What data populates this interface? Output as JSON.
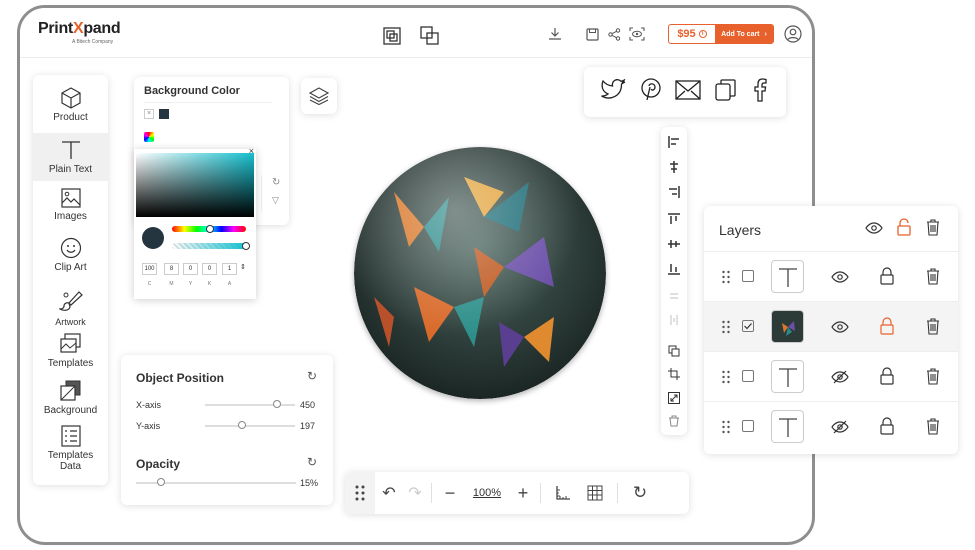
{
  "header": {
    "logo_text_a": "Print",
    "logo_text_x": "X",
    "logo_text_b": "pand",
    "logo_subtitle": "A Bitech Company",
    "price": "$95",
    "add_to_cart": "Add To cart"
  },
  "sidebar": {
    "items": [
      {
        "label": "Product",
        "icon": "cube-icon"
      },
      {
        "label": "Plain Text",
        "icon": "text-icon"
      },
      {
        "label": "Images",
        "icon": "image-icon"
      },
      {
        "label": "Clip Art",
        "icon": "smiley-icon"
      },
      {
        "label": "Artwork",
        "icon": "paintbrush-icon"
      },
      {
        "label": "Templates",
        "icon": "templates-icon"
      },
      {
        "label": "Background",
        "icon": "background-icon"
      },
      {
        "label": "Templates",
        "label2": "Data",
        "icon": "templates-data-icon"
      }
    ]
  },
  "background_color": {
    "title": "Background Color",
    "swatch_color": "#243540"
  },
  "color_picker": {
    "values": [
      "100",
      "8",
      "0",
      "0",
      "1"
    ],
    "labels": [
      "C",
      "M",
      "Y",
      "K",
      "A"
    ]
  },
  "object_position": {
    "title": "Object Position",
    "x_label": "X-axis",
    "x_value": "450",
    "y_label": "Y-axis",
    "y_value": "197",
    "opacity_title": "Opacity",
    "opacity_value": "15%"
  },
  "toolbar": {
    "zoom": "100%"
  },
  "layers": {
    "title": "Layers",
    "rows": [
      {
        "checked": false,
        "thumb": "text",
        "visible": true
      },
      {
        "checked": true,
        "thumb": "image",
        "visible": true,
        "unlocked": true
      },
      {
        "checked": false,
        "thumb": "text",
        "visible": false
      },
      {
        "checked": false,
        "thumb": "text",
        "visible": false
      }
    ]
  },
  "colors": {
    "accent": "#e8612c",
    "text": "#333333"
  }
}
